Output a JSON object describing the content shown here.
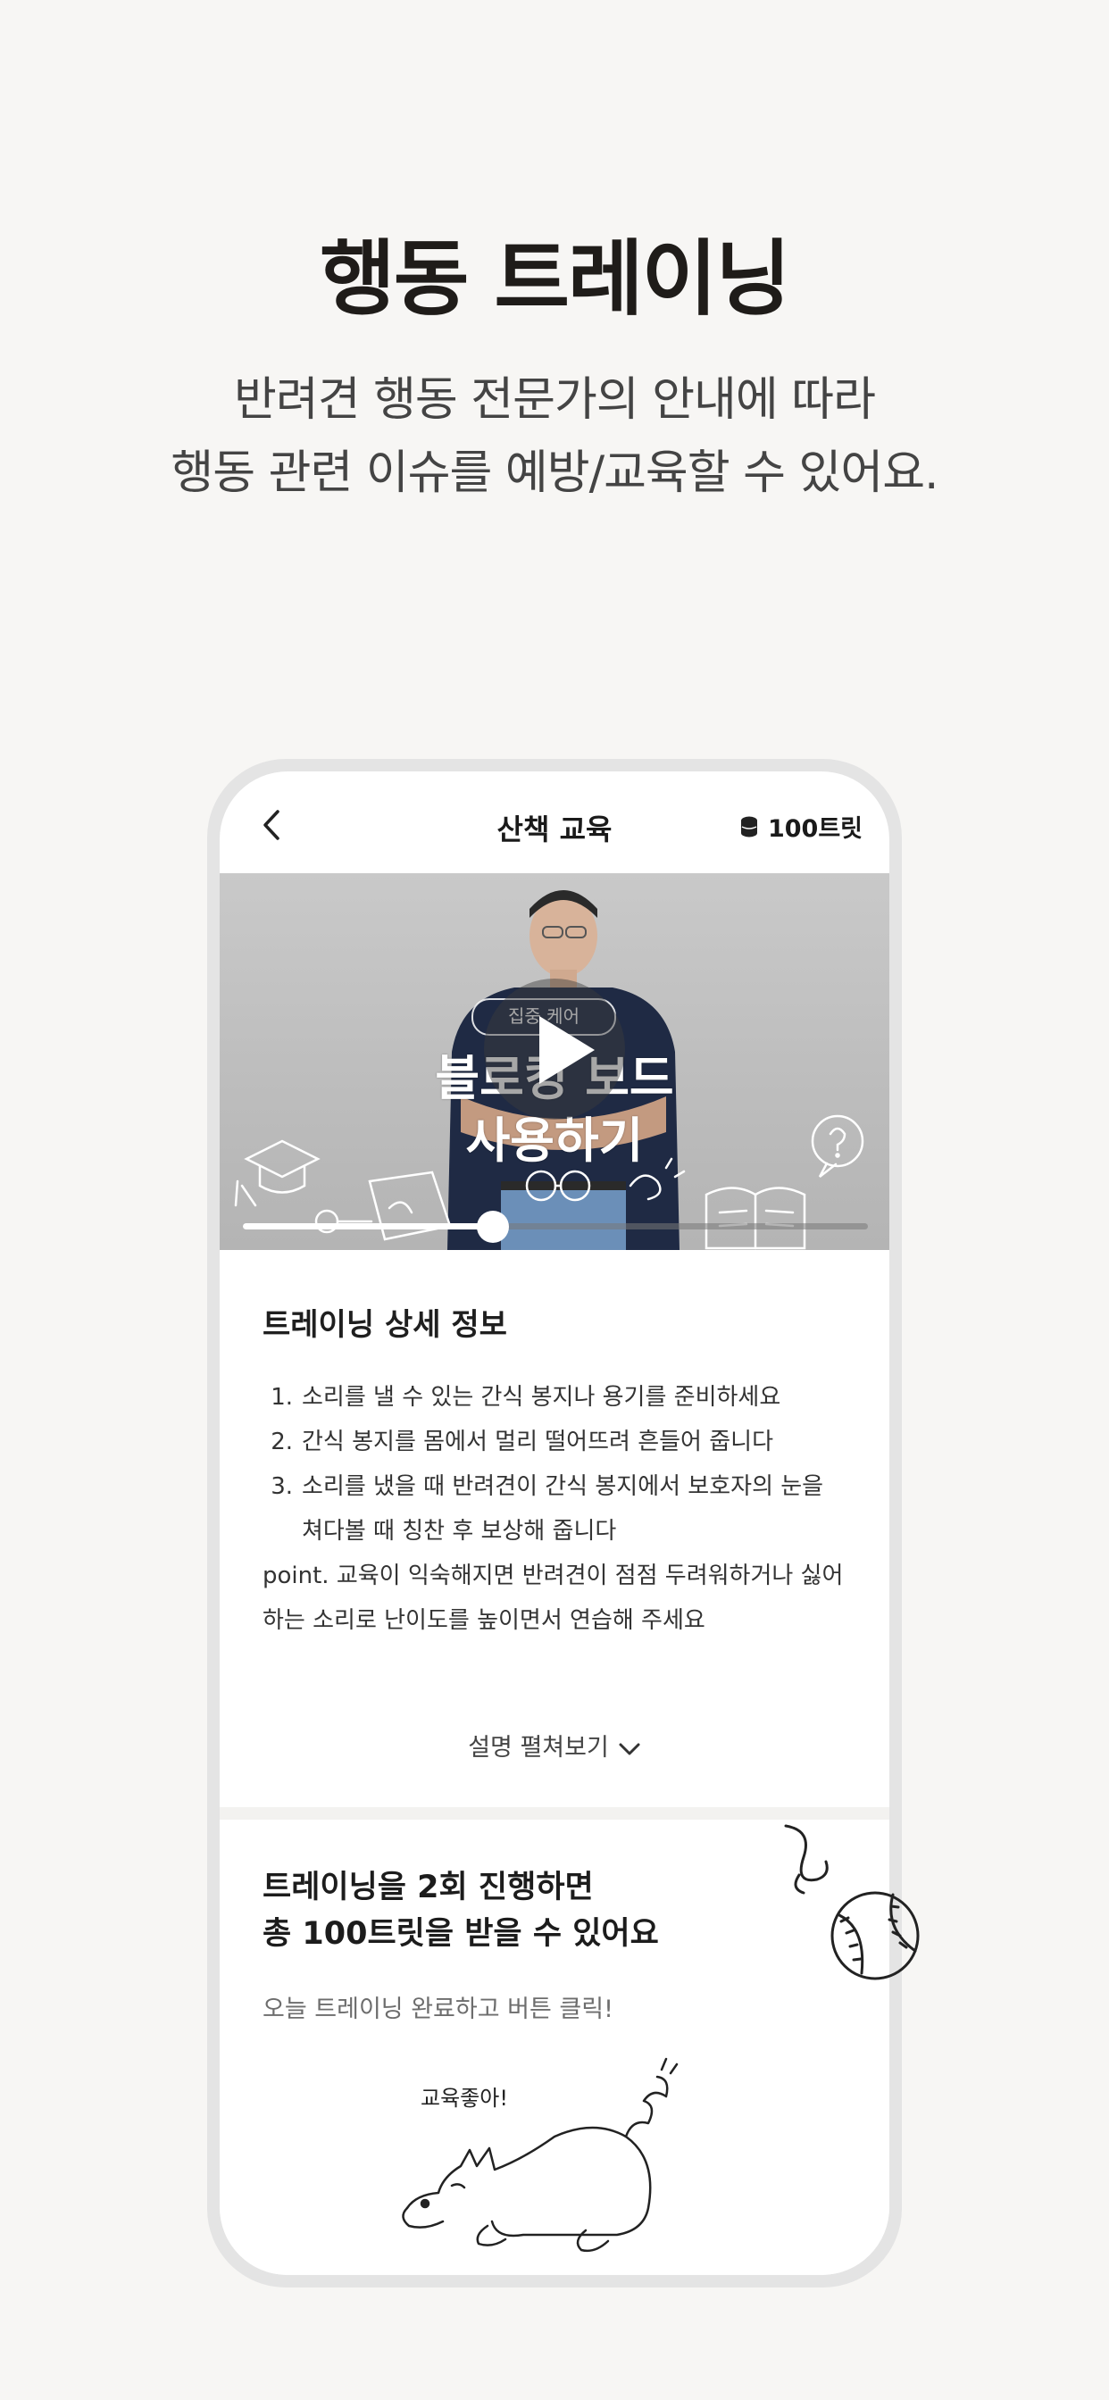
{
  "hero": {
    "title": "행동 트레이닝",
    "subtitle_line1": "반려견 행동 전문가의 안내에 따라",
    "subtitle_line2": "행동 관련 이슈를 예방/교육할 수 있어요."
  },
  "nav": {
    "back_icon": "chevron-left-icon",
    "title": "산책 교육",
    "points_icon": "coin-stack-icon",
    "points_label": "100트릿"
  },
  "video": {
    "tag": "집중 케어",
    "caption_line1": "블로킹 보드",
    "caption_line2": "사용하기",
    "play_icon": "play-icon",
    "progress": 0.4
  },
  "detail": {
    "title": "트레이닝 상세 정보",
    "steps": [
      {
        "num": "1.",
        "text": "소리를 낼 수 있는 간식 봉지나 용기를 준비하세요"
      },
      {
        "num": "2.",
        "text": "간식 봉지를 몸에서 멀리 떨어뜨려 흔들어 줍니다"
      },
      {
        "num": "3.",
        "text": "소리를 냈을 때 반려견이 간식 봉지에서 보호자의 눈을 쳐다볼 때 칭찬 후 보상해 줍니다"
      }
    ],
    "point": "point. 교육이 익숙해지면 반려견이 점점 두려워하거나 싫어하는 소리로 난이도를 높이면서 연습해 주세요",
    "expand_label": "설명 펼쳐보기"
  },
  "reward": {
    "title_line1": "트레이닝을 2회 진행하면",
    "title_line2": "총 100트릿을 받을 수 있어요",
    "subtitle": "오늘 트레이닝 완료하고 버튼 클릭!",
    "illustration_text": "교육좋아!"
  },
  "colors": {
    "background": "#f7f6f4",
    "phone_frame": "#e4e4e4",
    "text_dark": "#1f1c19"
  }
}
